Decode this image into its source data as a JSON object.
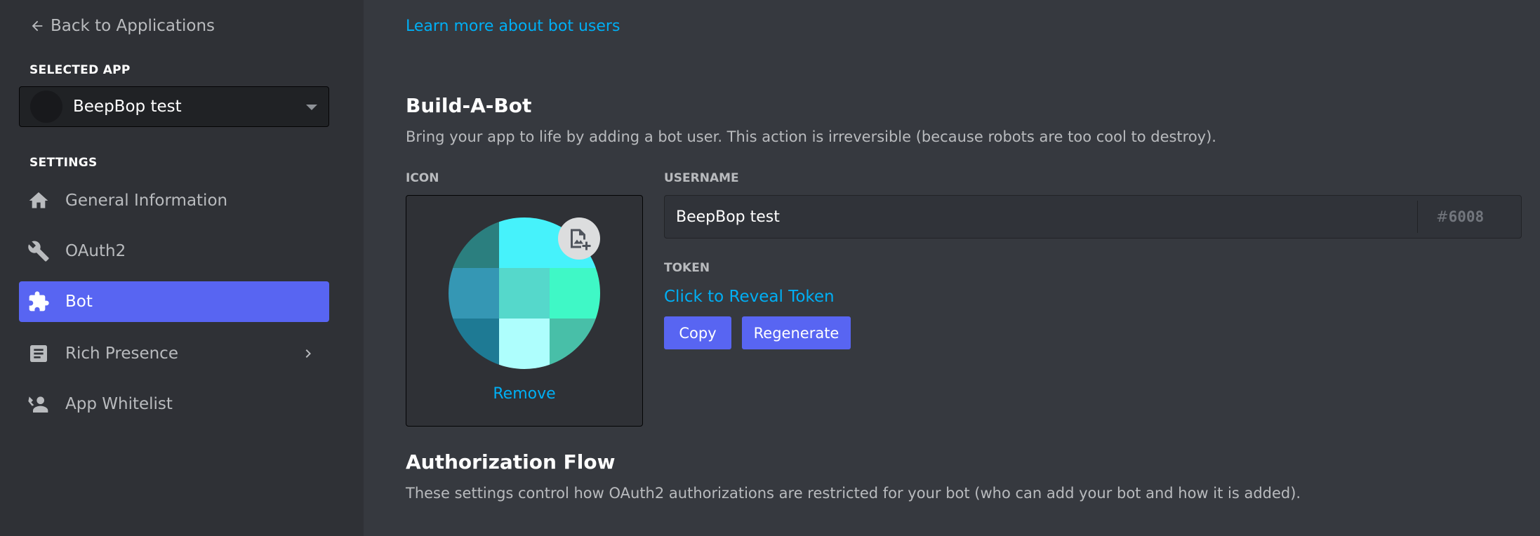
{
  "sidebar": {
    "back_label": "Back to Applications",
    "selected_app_heading": "SELECTED APP",
    "selected_app_name": "BeepBop test",
    "settings_heading": "SETTINGS",
    "items": [
      {
        "label": "General Information",
        "icon": "home-icon"
      },
      {
        "label": "OAuth2",
        "icon": "wrench-icon"
      },
      {
        "label": "Bot",
        "icon": "puzzle-icon",
        "active": true
      },
      {
        "label": "Rich Presence",
        "icon": "document-icon",
        "has_submenu": true
      },
      {
        "label": "App Whitelist",
        "icon": "person-icon"
      }
    ]
  },
  "main": {
    "learn_more_link": "Learn more about bot users",
    "build_title": "Build-A-Bot",
    "build_desc": "Bring your app to life by adding a bot user. This action is irreversible (because robots are too cool to destroy).",
    "icon_label": "ICON",
    "remove_label": "Remove",
    "username_label": "USERNAME",
    "username_value": "BeepBop test",
    "discriminator_prefix": "#",
    "discriminator": "6008",
    "token_label": "TOKEN",
    "reveal_token_label": "Click to Reveal Token",
    "copy_label": "Copy",
    "regenerate_label": "Regenerate",
    "auth_title": "Authorization Flow",
    "auth_desc": "These settings control how OAuth2 authorizations are restricted for your bot (who can add your bot and how it is added)."
  },
  "colors": {
    "background": "#36393f",
    "sidebar": "#2f3136",
    "accent": "#5865f2",
    "link": "#00aff4",
    "avatar_tiles": [
      "#2b7f7f",
      "#46f2fb",
      "#46f2fb",
      "#3597b4",
      "#55d8cb",
      "#3ff8c6",
      "#1e7a94",
      "#aefefd",
      "#48bfa8"
    ]
  }
}
